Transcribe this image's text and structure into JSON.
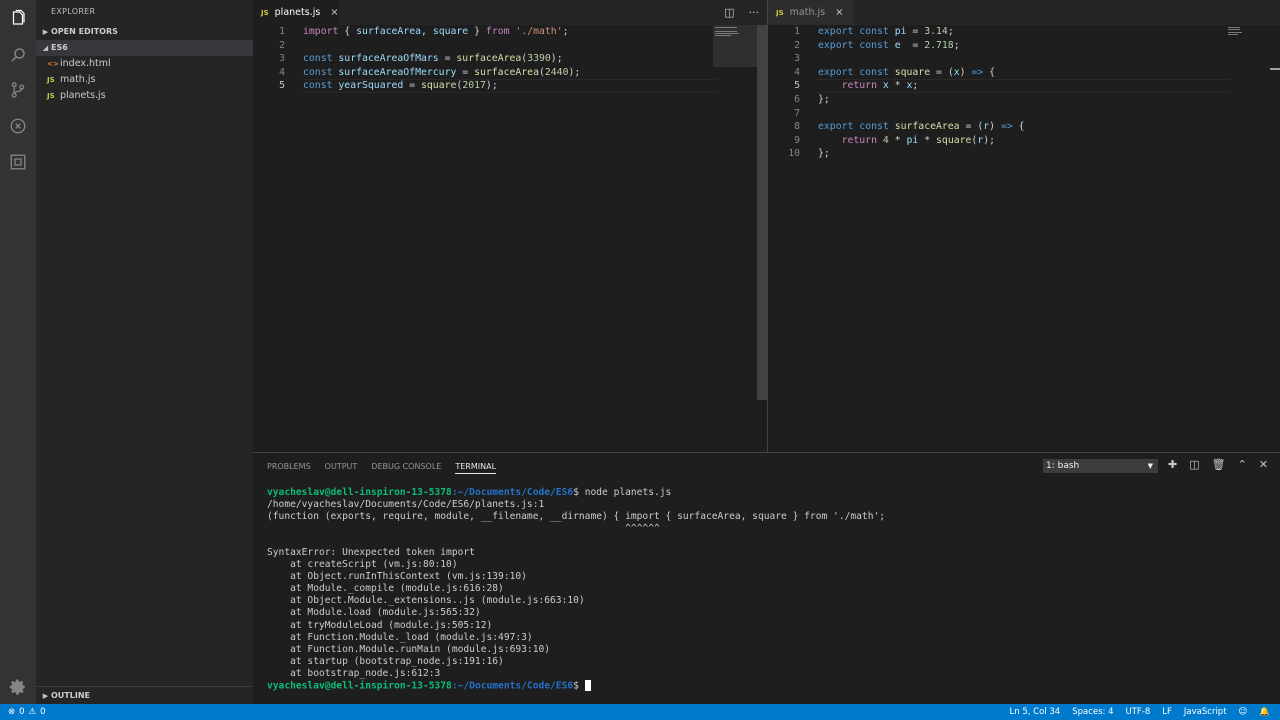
{
  "sidebar": {
    "title": "EXPLORER",
    "open_editors": "OPEN EDITORS",
    "folder": "ES6",
    "files": [
      {
        "name": "index.html",
        "badge": "<>",
        "type": "html"
      },
      {
        "name": "math.js",
        "badge": "JS",
        "type": "js"
      },
      {
        "name": "planets.js",
        "badge": "JS",
        "type": "js"
      }
    ],
    "outline": "OUTLINE"
  },
  "activity_icons": [
    "explorer-icon",
    "search-icon",
    "source-control-icon",
    "debug-icon",
    "extensions-icon",
    "settings-gear-icon"
  ],
  "left_editor": {
    "tab": {
      "badge": "JS",
      "name": "planets.js"
    },
    "current_line": 5,
    "lines": [
      "import { surfaceArea, square } from './math';",
      "",
      "const surfaceAreaOfMars = surfaceArea(3390);",
      "const surfaceAreaOfMercury = surfaceArea(2440);",
      "const yearSquared = square(2017);"
    ]
  },
  "right_editor": {
    "tab": {
      "badge": "JS",
      "name": "math.js"
    },
    "current_line": 5,
    "lines": [
      "export const pi = 3.14;",
      "export const e  = 2.718;",
      "",
      "export const square = (x) => {",
      "    return x * x;",
      "};",
      "",
      "export const surfaceArea = (r) => {",
      "    return 4 * pi * square(r);",
      "};"
    ]
  },
  "panel": {
    "tabs": [
      "PROBLEMS",
      "OUTPUT",
      "DEBUG CONSOLE",
      "TERMINAL"
    ],
    "active_tab": "TERMINAL",
    "terminal_select": "1: bash",
    "prompt_user": "vyacheslav@dell-inspiron-13-5378",
    "prompt_path": ":~/Documents/Code/ES6",
    "command": "$ node planets.js",
    "output": [
      "/home/vyacheslav/Documents/Code/ES6/planets.js:1",
      "(function (exports, require, module, __filename, __dirname) { import { surfaceArea, square } from './math';",
      "                                                              ^^^^^^",
      "",
      "SyntaxError: Unexpected token import",
      "    at createScript (vm.js:80:10)",
      "    at Object.runInThisContext (vm.js:139:10)",
      "    at Module._compile (module.js:616:28)",
      "    at Object.Module._extensions..js (module.js:663:10)",
      "    at Module.load (module.js:565:32)",
      "    at tryModuleLoad (module.js:505:12)",
      "    at Function.Module._load (module.js:497:3)",
      "    at Function.Module.runMain (module.js:693:10)",
      "    at startup (bootstrap_node.js:191:16)",
      "    at bootstrap_node.js:612:3"
    ],
    "final_prompt_suffix": "$ "
  },
  "status": {
    "errors": "0",
    "warnings": "0",
    "position": "Ln 5, Col 34",
    "spaces": "Spaces: 4",
    "encoding": "UTF-8",
    "eol": "LF",
    "language": "JavaScript"
  },
  "colors": {
    "status_bar": "#007acc",
    "activity_bar": "#333333",
    "sidebar": "#252526",
    "editor": "#1e1e1e"
  }
}
